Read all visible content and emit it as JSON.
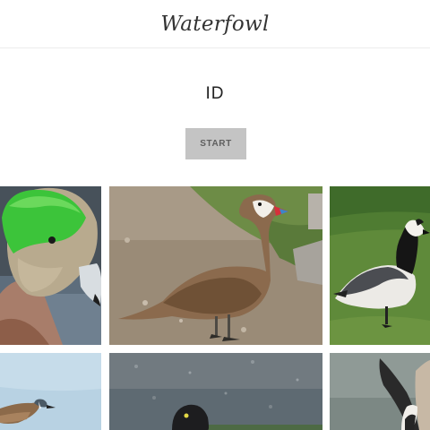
{
  "header": {
    "title": "Waterfowl"
  },
  "main": {
    "heading": "ID",
    "start_label": "START"
  },
  "gallery": {
    "images": [
      {
        "subject": "american-wigeon-drake"
      },
      {
        "subject": "white-cheeked-pintail"
      },
      {
        "subject": "barnacle-goose"
      },
      {
        "subject": "blue-winged-teal"
      },
      {
        "subject": "diving-duck-on-gravel"
      },
      {
        "subject": "flying-waterfowl"
      }
    ]
  }
}
